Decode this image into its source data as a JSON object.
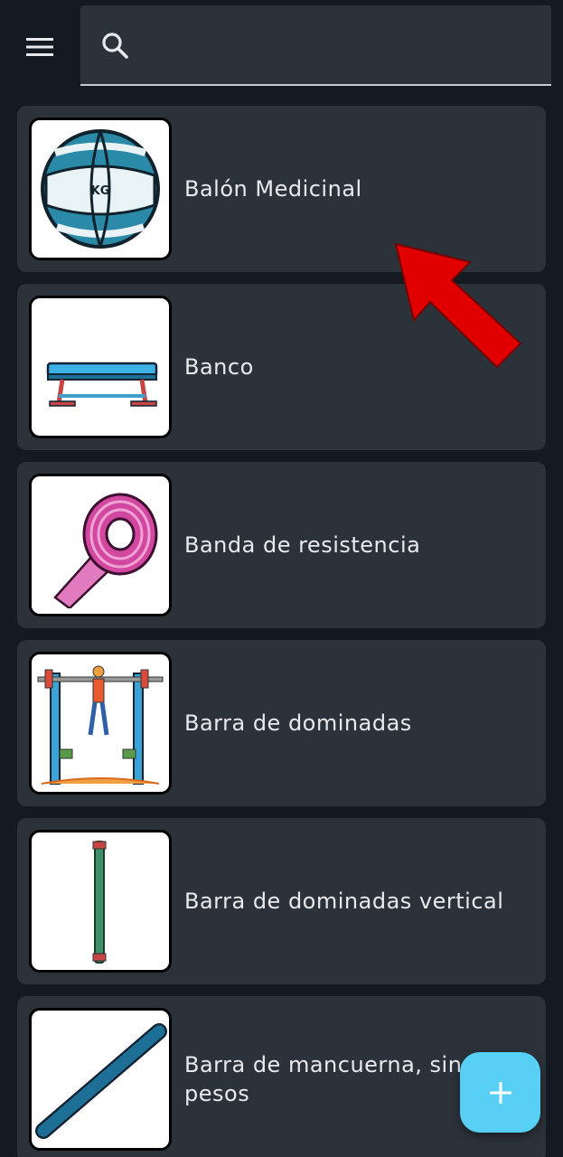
{
  "header": {
    "menu_icon": "hamburger-menu-icon",
    "search_icon": "search-icon",
    "search_value": "",
    "search_placeholder": ""
  },
  "equipment": [
    {
      "name": "Balón Medicinal",
      "icon": "medicine-ball-icon"
    },
    {
      "name": "Banco",
      "icon": "bench-icon"
    },
    {
      "name": "Banda de resistencia",
      "icon": "resistance-band-icon"
    },
    {
      "name": "Barra de dominadas",
      "icon": "pull-up-bar-icon"
    },
    {
      "name": "Barra de dominadas vertical",
      "icon": "vertical-pull-up-bar-icon"
    },
    {
      "name": "Barra de mancuerna, sin pesos",
      "icon": "dumbbell-bar-icon"
    }
  ],
  "fab": {
    "icon": "plus-icon",
    "label": "+"
  },
  "annotation": {
    "icon": "red-arrow-icon"
  },
  "colors": {
    "background": "#141a21",
    "card": "#2c323a",
    "accent": "#58d0f5",
    "arrow": "#e00000"
  }
}
